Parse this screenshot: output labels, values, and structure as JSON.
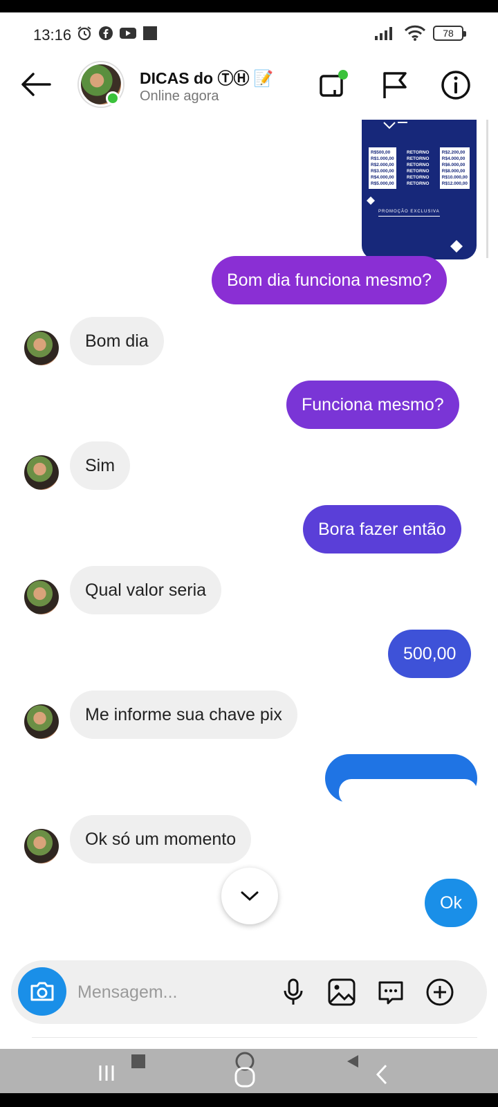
{
  "status_bar": {
    "time": "13:16",
    "battery": "78"
  },
  "header": {
    "title": "DICAS do ⓉⒽ 📝",
    "subtitle": "Online agora"
  },
  "image_card": {
    "col1": [
      "R$500,00",
      "R$1.000,00",
      "R$2.000,00",
      "R$3.000,00",
      "R$4.000,00",
      "R$5.000,00"
    ],
    "col2": [
      "RETORNO",
      "RETORNO",
      "RETORNO",
      "RETORNO",
      "RETORNO",
      "RETORNO"
    ],
    "col3": [
      "R$2.200,00",
      "R$4.000,00",
      "R$6.000,00",
      "R$8.000,00",
      "R$10.000,00",
      "R$12.000,00"
    ],
    "footer": "PROMOÇÃO EXCLUSIVA"
  },
  "messages": [
    {
      "text": "Bom dia funciona mesmo?",
      "sender": "me",
      "color": "#8a2fd4"
    },
    {
      "text": "Bom dia",
      "sender": "them"
    },
    {
      "text": "Funciona mesmo?",
      "sender": "me",
      "color": "#7a35d6"
    },
    {
      "text": "Sim",
      "sender": "them"
    },
    {
      "text": "Bora fazer então",
      "sender": "me",
      "color": "#5a3fd8"
    },
    {
      "text": "Qual valor seria",
      "sender": "them"
    },
    {
      "text": "500,00",
      "sender": "me",
      "color": "#3e52d8"
    },
    {
      "text": "Me informe sua chave pix",
      "sender": "them"
    },
    {
      "text": "",
      "sender": "me",
      "color": "#1f74e4",
      "redacted": true
    },
    {
      "text": "Ok só um momento",
      "sender": "them"
    },
    {
      "text": "Ok",
      "sender": "me",
      "color": "#1a8fe8"
    }
  ],
  "composer": {
    "placeholder": "Mensagem..."
  },
  "colors": {
    "online": "#3bc23b",
    "camera_button": "#1a8fe8",
    "nav_bar": "#b3b3b3"
  }
}
